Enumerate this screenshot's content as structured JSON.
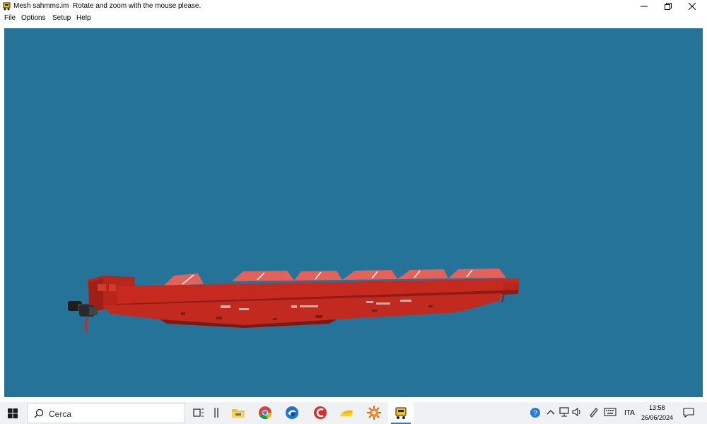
{
  "window": {
    "title": "Mesh sahmms.im",
    "hint": "Rotate and zoom with the mouse please.",
    "controls": {
      "minimize": "minimize",
      "restore": "restore",
      "close": "close"
    }
  },
  "menu": {
    "file": "File",
    "options": "Options",
    "setup": "Setup",
    "help": "Help"
  },
  "viewport": {
    "background": "#26739a",
    "model_color": "#c62a1e",
    "model": "red flat freight wagon"
  },
  "taskbar": {
    "search_label": "Cerca",
    "pinned_apps": [
      "task-view",
      "file-explorer",
      "chrome",
      "thunderbird",
      "ccleaner",
      "folder-app",
      "xnview",
      "mesh-viewer"
    ],
    "language": "ITA",
    "time": "13:58",
    "date": "26/06/2024"
  }
}
